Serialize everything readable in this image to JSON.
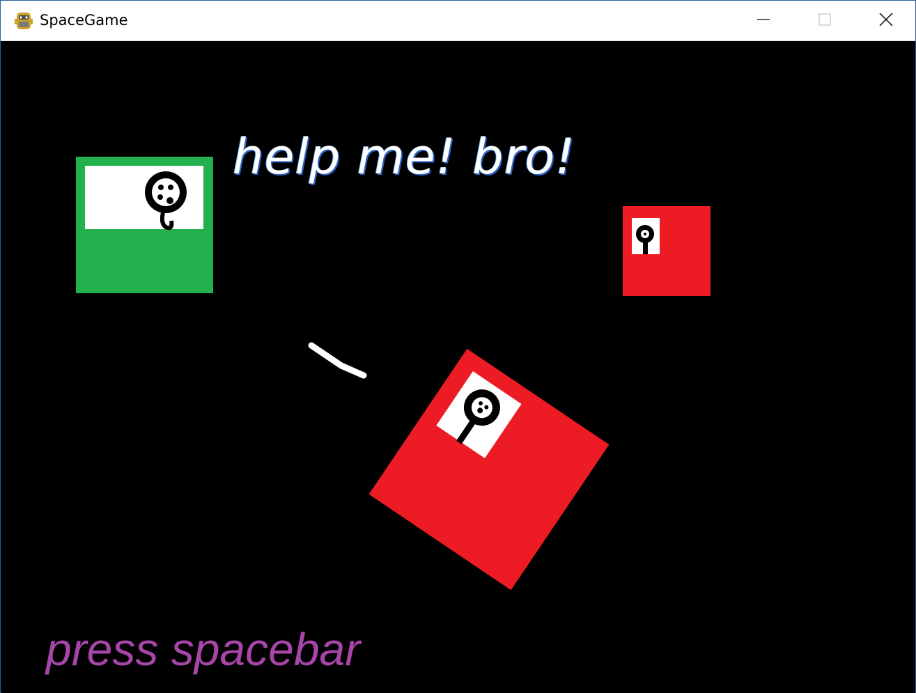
{
  "window": {
    "title": "SpaceGame",
    "app_icon": "python-snake-icon",
    "controls": [
      "minimize-icon",
      "maximize-icon",
      "close-icon"
    ]
  },
  "game": {
    "message": "help me! bro!",
    "prompt": "press spacebar",
    "colors": {
      "background": "#000000",
      "player_box": "#22b14c",
      "enemy_box": "#ed1c24",
      "message": "#ffffff",
      "prompt": "#a349a4"
    }
  }
}
